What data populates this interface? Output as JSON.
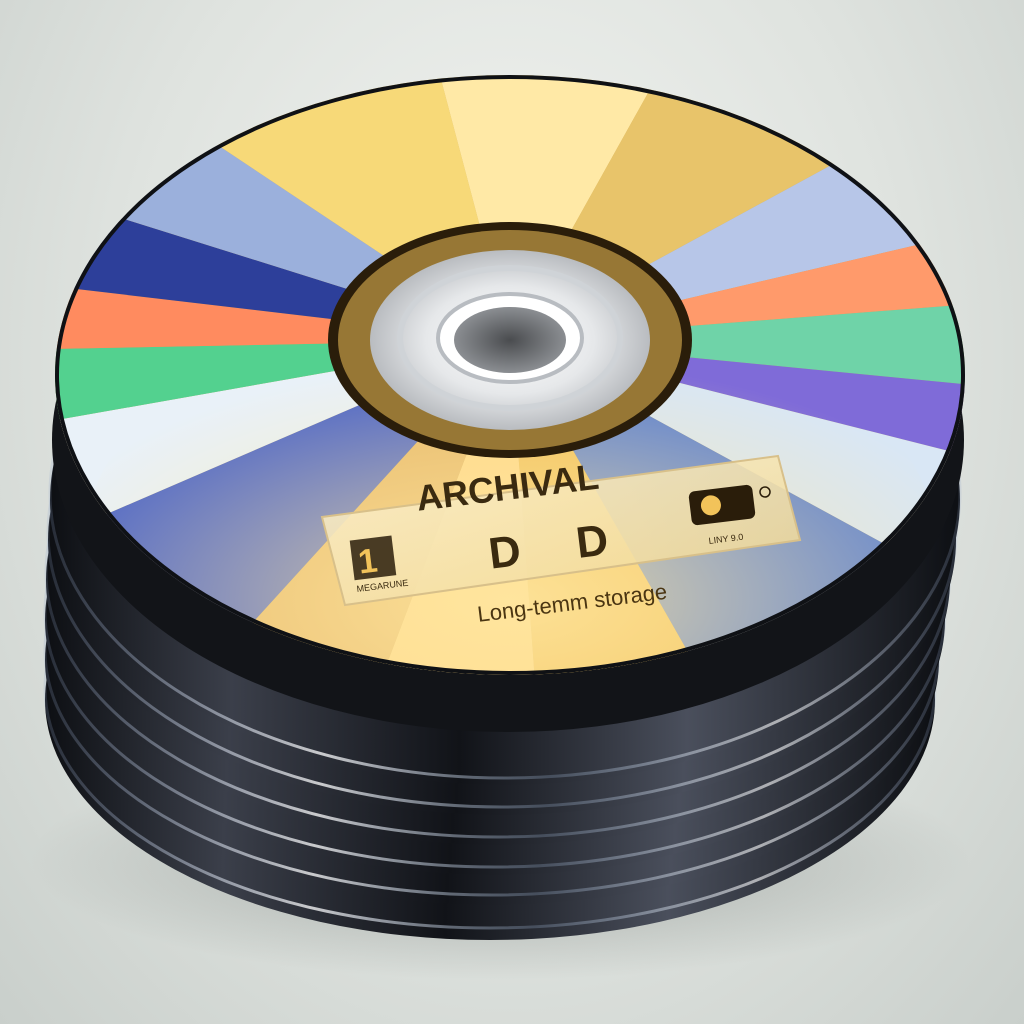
{
  "disc": {
    "label_line1": "ARCHIVAL",
    "label_line2": "D D",
    "label_small_left": "MEGARUNE",
    "label_small_right": "LINY 9.0",
    "tagline": "Long-temm storage"
  },
  "colors": {
    "background": "#e2e6e2",
    "disc_gold": "#f2c35a",
    "disc_edge": "#1a1d22",
    "label_text": "#3a2a10",
    "label_panel": "#f6e6b8"
  },
  "icons": {
    "label_logo_left": "number-one-logo",
    "label_logo_right": "media-badge-logo"
  }
}
